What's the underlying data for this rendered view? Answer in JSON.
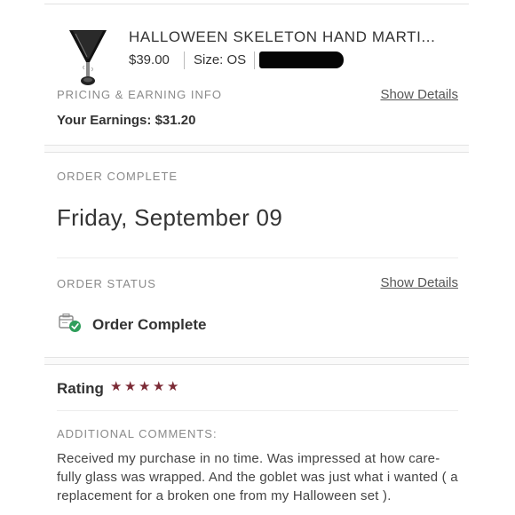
{
  "product": {
    "title": "HALLOWEEN SKELETON HAND MARTI...",
    "price": "$39.00",
    "size": "Size: OS"
  },
  "pricing": {
    "label": "PRICING & EARNING INFO",
    "show_details": "Show Details",
    "earnings": "Your Earnings: $31.20"
  },
  "order_complete": {
    "label": "ORDER COMPLETE",
    "date": "Friday, September 09"
  },
  "order_status": {
    "label": "ORDER STATUS",
    "show_details": "Show Details",
    "status": "Order Complete"
  },
  "rating": {
    "label": "Rating",
    "stars": 5,
    "max_stars": 5,
    "star_color": "#7b2a35"
  },
  "comments": {
    "label": "ADDITIONAL COMMENTS:",
    "text": "Received my purchase in no time. Was impressed at how care-fully glass was wrapped. And the goblet was just what i wanted ( a replacement for a broken one from my Halloween set )."
  },
  "icons": {
    "product": "martini-glass-thumbnail",
    "status": "package-check-icon",
    "rating": "star-icon"
  }
}
